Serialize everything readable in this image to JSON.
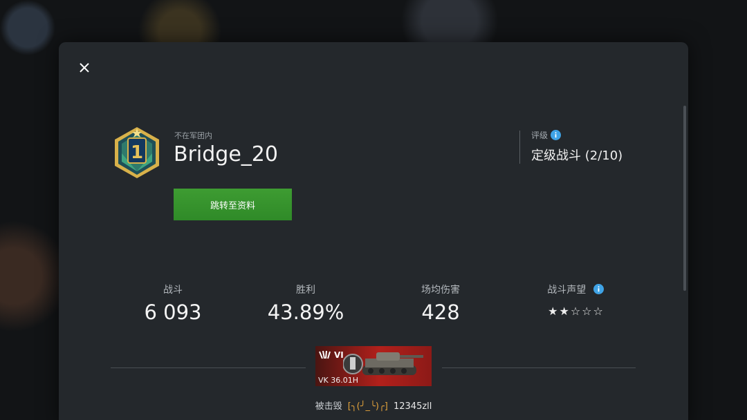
{
  "header": {
    "close_icon": "close-icon"
  },
  "player": {
    "clan_status": "不在军团内",
    "name": "Bridge_20",
    "emblem_rank": "1",
    "profile_button": "跳转至资料"
  },
  "rating": {
    "label": "评级",
    "value": "定级战斗 (2/10)"
  },
  "stats": [
    {
      "label": "战斗",
      "value": "6 093"
    },
    {
      "label": "胜利",
      "value": "43.89%"
    },
    {
      "label": "场均伤害",
      "value": "428"
    }
  ],
  "reputation": {
    "label": "战斗声望",
    "stars_filled": 2,
    "stars_total": 5
  },
  "killed_by": {
    "tank_tier": "VI",
    "tank_name": "VK 36.01H",
    "prefix": "被击毁",
    "clan_tag": "[╮(╯_╰)╭]",
    "player": "12345zll"
  },
  "colors": {
    "accent_green": "#36952d",
    "info_blue": "#3fa3e6",
    "tank_red": "#b2201b"
  }
}
